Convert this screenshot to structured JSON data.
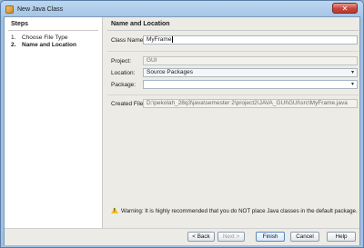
{
  "window": {
    "title": "New Java Class",
    "close_glyph": "✕"
  },
  "steps": {
    "title": "Steps",
    "items": [
      {
        "num": "1.",
        "label": "Choose File Type"
      },
      {
        "num": "2.",
        "label": "Name and Location"
      }
    ]
  },
  "form": {
    "title": "Name and Location",
    "class_name_label": "Class Name:",
    "class_name_value": "MyFrame",
    "project_label": "Project:",
    "project_value": "GUI",
    "location_label": "Location:",
    "location_value": "Source Packages",
    "package_label": "Package:",
    "package_value": "",
    "created_file_label": "Created File:",
    "created_file_value": "D:\\pekolah_28q3\\java\\semester 2\\project2\\JAVA_GUI\\GUI\\src\\MyFrame.java"
  },
  "warning": {
    "text": "Warning: It is highly recommended that you do NOT place Java classes in the default package."
  },
  "buttons": {
    "back": "< Back",
    "next": "Next >",
    "finish": "Finish",
    "cancel": "Cancel",
    "help": "Help"
  },
  "icons": {
    "app": "java-class-icon",
    "warning": "warning-icon",
    "dropdown": "chevron-down-icon"
  }
}
